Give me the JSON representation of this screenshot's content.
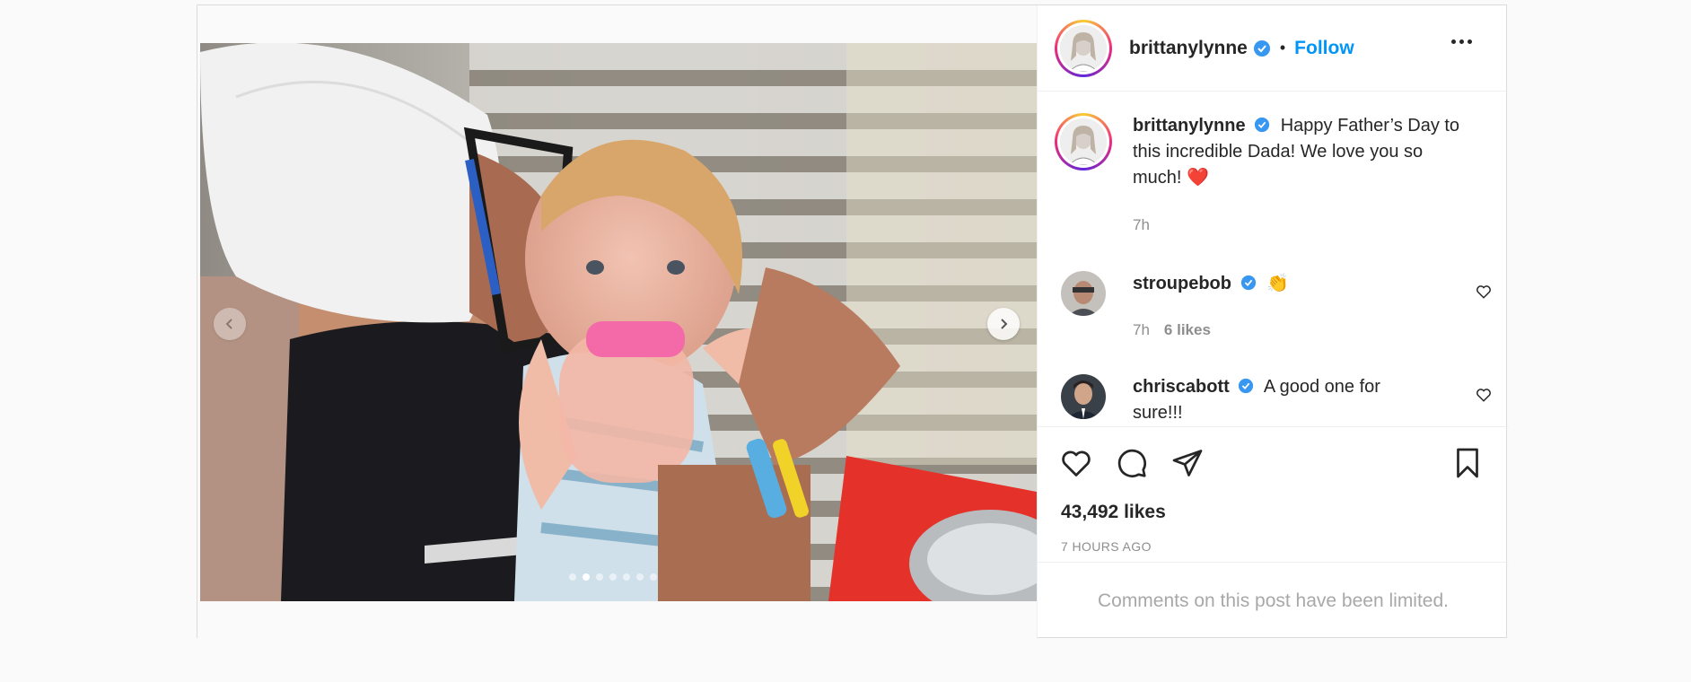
{
  "post": {
    "username": "brittanylynne",
    "follow_label": "Follow",
    "separator": "•",
    "carousel": {
      "total_slides": 7,
      "active_index": 1
    }
  },
  "caption": {
    "username": "brittanylynne",
    "text": "Happy Father’s Day to this incredible Dada! We love you so much! ❤️",
    "time": "7h"
  },
  "comments": [
    {
      "username": "stroupebob",
      "text": "👏",
      "time": "7h",
      "likes": "6 likes"
    },
    {
      "username": "chriscabott",
      "text": "A good one for sure!!!"
    }
  ],
  "stats": {
    "likes": "43,492 likes",
    "posted": "7 HOURS AGO"
  },
  "footer": {
    "notice": "Comments on this post have been limited."
  },
  "icons": {
    "verified": "verified-badge-icon",
    "more": "more-options-icon",
    "like": "heart-icon",
    "comment": "comment-icon",
    "share": "share-icon",
    "save": "bookmark-icon"
  },
  "colors": {
    "accent": "#0095f6",
    "verified": "#3897f0",
    "text": "#262626",
    "muted": "#8e8e8e"
  }
}
